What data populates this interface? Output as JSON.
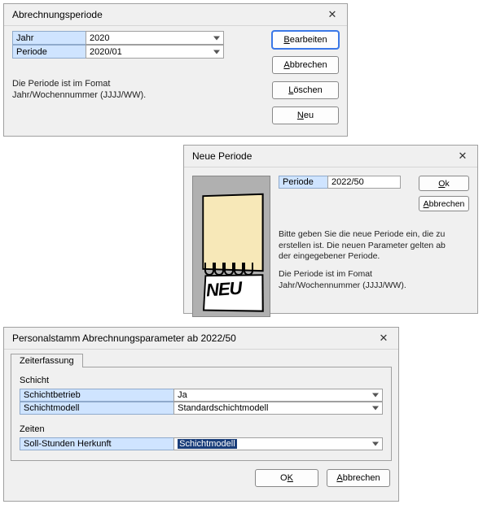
{
  "dlg1": {
    "title": "Abrechnungsperiode",
    "close_symbol": "✕",
    "year_label": "Jahr",
    "year_value": "2020",
    "period_label": "Periode",
    "period_value": "2020/01",
    "hint1": "Die Periode ist im Fomat",
    "hint2": "Jahr/Wochennummer (JJJJ/WW).",
    "buttons": {
      "edit_ul": "B",
      "edit_rest": "earbeiten",
      "cancel_ul": "A",
      "cancel_rest": "bbrechen",
      "delete_ul": "L",
      "delete_rest": "öschen",
      "new_ul": "N",
      "new_rest": "eu"
    }
  },
  "dlg2": {
    "title": "Neue Periode",
    "close_symbol": "✕",
    "period_label": "Periode",
    "period_value": "2022/50",
    "hint1": "Bitte geben Sie die neue Periode ein, die zu erstellen ist. Die neuen Parameter gelten ab der eingegebener Periode.",
    "hint2a": "Die Periode ist im Fomat",
    "hint2b": "Jahr/Wochennummer (JJJJ/WW).",
    "neu_text": "NEU",
    "buttons": {
      "ok_ul": "O",
      "ok_rest": "k",
      "cancel_ul": "A",
      "cancel_rest": "bbrechen"
    }
  },
  "dlg3": {
    "title": "Personalstamm Abrechnungsparameter ab 2022/50",
    "close_symbol": "✕",
    "tab_label": "Zeiterfassung",
    "section_shift": "Schicht",
    "shift_op_label": "Schichtbetrieb",
    "shift_op_value": "Ja",
    "shift_model_label": "Schichtmodell",
    "shift_model_value": "Standardschichtmodell",
    "section_times": "Zeiten",
    "target_src_label": "Soll-Stunden Herkunft",
    "target_src_value": "Schichtmodell",
    "buttons": {
      "ok_pre": "O",
      "ok_ul": "K",
      "cancel_ul": "A",
      "cancel_rest": "bbrechen"
    }
  }
}
